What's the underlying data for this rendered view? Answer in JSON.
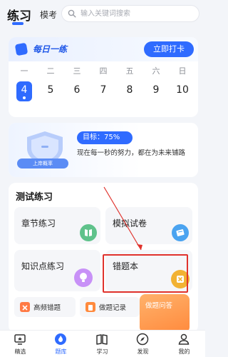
{
  "header": {
    "tab_active": "练习",
    "tab_other": "模考",
    "search_placeholder": "输入关键词搜索"
  },
  "daily": {
    "title": "每日一练",
    "checkin_label": "立即打卡",
    "days": [
      {
        "weekday": "一",
        "date": "4",
        "active": true
      },
      {
        "weekday": "二",
        "date": "5",
        "active": false
      },
      {
        "weekday": "三",
        "date": "6",
        "active": false
      },
      {
        "weekday": "四",
        "date": "7",
        "active": false
      },
      {
        "weekday": "五",
        "date": "8",
        "active": false
      },
      {
        "weekday": "六",
        "date": "9",
        "active": false
      },
      {
        "weekday": "日",
        "date": "10",
        "active": false
      }
    ]
  },
  "goal": {
    "badge_label": "上岸概率",
    "target_label": "目标：75%",
    "motto": "现在每一秒的努力，都在为未来铺路"
  },
  "practice": {
    "title": "测试练习",
    "cards": [
      {
        "label": "章节练习",
        "icon": "book-icon",
        "color": "#5fc28b"
      },
      {
        "label": "模拟试卷",
        "icon": "paper-icon",
        "color": "#4aa3f0"
      },
      {
        "label": "知识点练习",
        "icon": "bulb-icon",
        "color": "#b86cf2"
      },
      {
        "label": "错题本",
        "icon": "wrong-icon",
        "color": "#f2b233"
      }
    ],
    "minis": [
      {
        "label": "高频错题",
        "icon": "error-icon",
        "color": "#ff7a45"
      },
      {
        "label": "做题记录",
        "icon": "record-icon",
        "color": "#ff8a3d"
      },
      {
        "label": "做题问答",
        "icon": "qa-icon",
        "color": "#ffffff"
      }
    ]
  },
  "nav": {
    "items": [
      {
        "label": "精选",
        "icon": "featured-icon"
      },
      {
        "label": "题库",
        "icon": "question-bank-icon"
      },
      {
        "label": "学习",
        "icon": "study-icon"
      },
      {
        "label": "发现",
        "icon": "discover-icon"
      },
      {
        "label": "我的",
        "icon": "profile-icon"
      }
    ]
  },
  "colors": {
    "accent": "#2f6bff",
    "highlight": "#e0322c"
  }
}
